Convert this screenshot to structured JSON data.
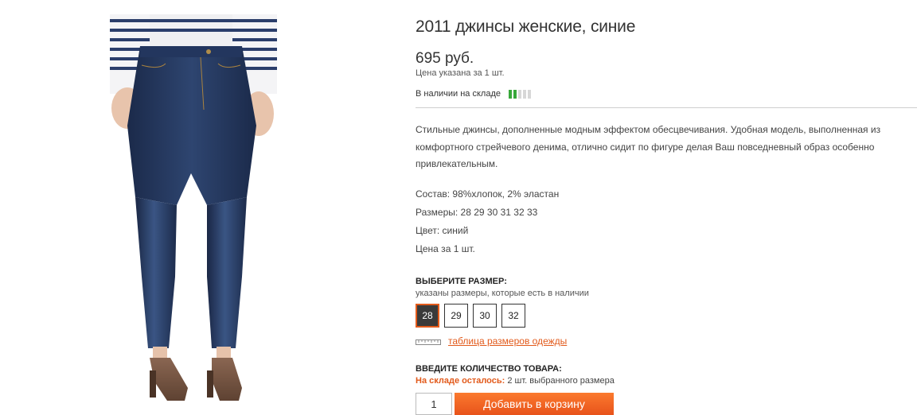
{
  "product": {
    "title": "2011 джинсы женские, синие",
    "price": "695 руб.",
    "price_note": "Цена указана за 1 шт.",
    "stock_label": "В наличии на складе",
    "stock_level": {
      "filled": 2,
      "total": 5
    },
    "description": "Стильные джинсы, дополненные модным эффектом обесцвечивания. Удобная модель, выполненная из комфортного стрейчевого денима, отлично сидит по фигуре делая Ваш повседневный образ особенно привлекательным.",
    "specs": [
      "Состав: 98%хлопок, 2% эластан",
      "Размеры: 28 29 30 31 32 33",
      "Цвет: синий",
      "Цена за 1 шт."
    ],
    "image_icon": "jeans-photo"
  },
  "size_select": {
    "heading": "ВЫБЕРИТЕ РАЗМЕР:",
    "subtext": "указаны размеры, которые есть в наличии",
    "sizes": [
      "28",
      "29",
      "30",
      "32"
    ],
    "selected": "28",
    "size_table_icon": "ruler-icon",
    "size_table_link": "таблица размеров одежды"
  },
  "quantity": {
    "heading": "ВВЕДИТЕ КОЛИЧЕСТВО ТОВАРА:",
    "remaining_label": "На складе осталось:",
    "remaining_text": " 2 шт. выбранного размера",
    "value": "1",
    "add_to_cart": "Добавить в корзину"
  },
  "colors": {
    "accent": "#e25a1b",
    "stock_on": "#37a83a",
    "stock_off": "#d7d7d7",
    "button_top": "#fb7a2e",
    "button_bottom": "#e8531b"
  }
}
